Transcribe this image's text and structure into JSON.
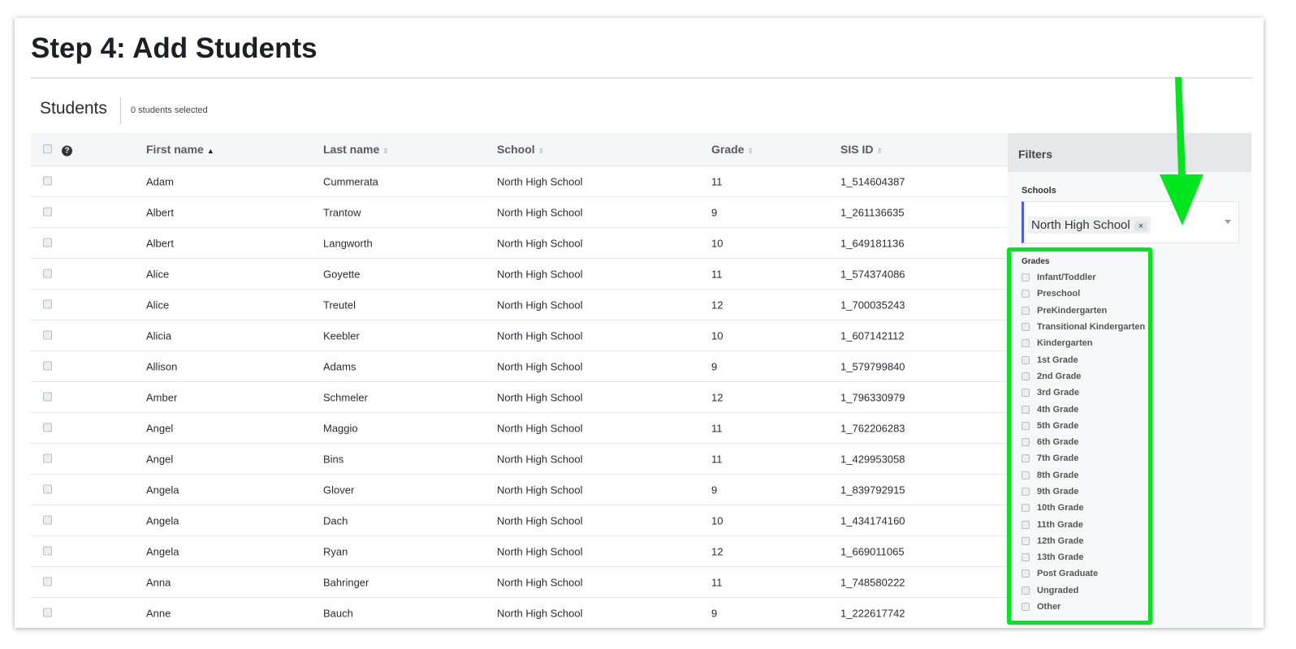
{
  "page": {
    "title": "Step 4: Add Students"
  },
  "students": {
    "section_title": "Students",
    "selected_count": "0 students selected"
  },
  "table": {
    "headers": {
      "first_name": "First name",
      "last_name": "Last name",
      "school": "School",
      "grade": "Grade",
      "sis_id": "SIS ID"
    },
    "sorted_column": "first_name",
    "sort_direction": "ascending",
    "rows": [
      {
        "first": "Adam",
        "last": "Cummerata",
        "school": "North High School",
        "grade": "11",
        "sis": "1_514604387"
      },
      {
        "first": "Albert",
        "last": "Trantow",
        "school": "North High School",
        "grade": "9",
        "sis": "1_261136635"
      },
      {
        "first": "Albert",
        "last": "Langworth",
        "school": "North High School",
        "grade": "10",
        "sis": "1_649181136"
      },
      {
        "first": "Alice",
        "last": "Goyette",
        "school": "North High School",
        "grade": "11",
        "sis": "1_574374086"
      },
      {
        "first": "Alice",
        "last": "Treutel",
        "school": "North High School",
        "grade": "12",
        "sis": "1_700035243"
      },
      {
        "first": "Alicia",
        "last": "Keebler",
        "school": "North High School",
        "grade": "10",
        "sis": "1_607142112"
      },
      {
        "first": "Allison",
        "last": "Adams",
        "school": "North High School",
        "grade": "9",
        "sis": "1_579799840"
      },
      {
        "first": "Amber",
        "last": "Schmeler",
        "school": "North High School",
        "grade": "12",
        "sis": "1_796330979"
      },
      {
        "first": "Angel",
        "last": "Maggio",
        "school": "North High School",
        "grade": "11",
        "sis": "1_762206283"
      },
      {
        "first": "Angel",
        "last": "Bins",
        "school": "North High School",
        "grade": "11",
        "sis": "1_429953058"
      },
      {
        "first": "Angela",
        "last": "Glover",
        "school": "North High School",
        "grade": "9",
        "sis": "1_839792915"
      },
      {
        "first": "Angela",
        "last": "Dach",
        "school": "North High School",
        "grade": "10",
        "sis": "1_434174160"
      },
      {
        "first": "Angela",
        "last": "Ryan",
        "school": "North High School",
        "grade": "12",
        "sis": "1_669011065"
      },
      {
        "first": "Anna",
        "last": "Bahringer",
        "school": "North High School",
        "grade": "11",
        "sis": "1_748580222"
      },
      {
        "first": "Anne",
        "last": "Bauch",
        "school": "North High School",
        "grade": "9",
        "sis": "1_222617742"
      }
    ]
  },
  "filters": {
    "title": "Filters",
    "schools_label": "Schools",
    "selected_school": "North High School",
    "remove_symbol": "×",
    "grades_label": "Grades",
    "grades": [
      "Infant/Toddler",
      "Preschool",
      "PreKindergarten",
      "Transitional Kindergarten",
      "Kindergarten",
      "1st Grade",
      "2nd Grade",
      "3rd Grade",
      "4th Grade",
      "5th Grade",
      "6th Grade",
      "7th Grade",
      "8th Grade",
      "9th Grade",
      "10th Grade",
      "11th Grade",
      "12th Grade",
      "13th Grade",
      "Post Graduate",
      "Ungraded",
      "Other"
    ]
  },
  "annotation": {
    "color": "#00e61e"
  }
}
